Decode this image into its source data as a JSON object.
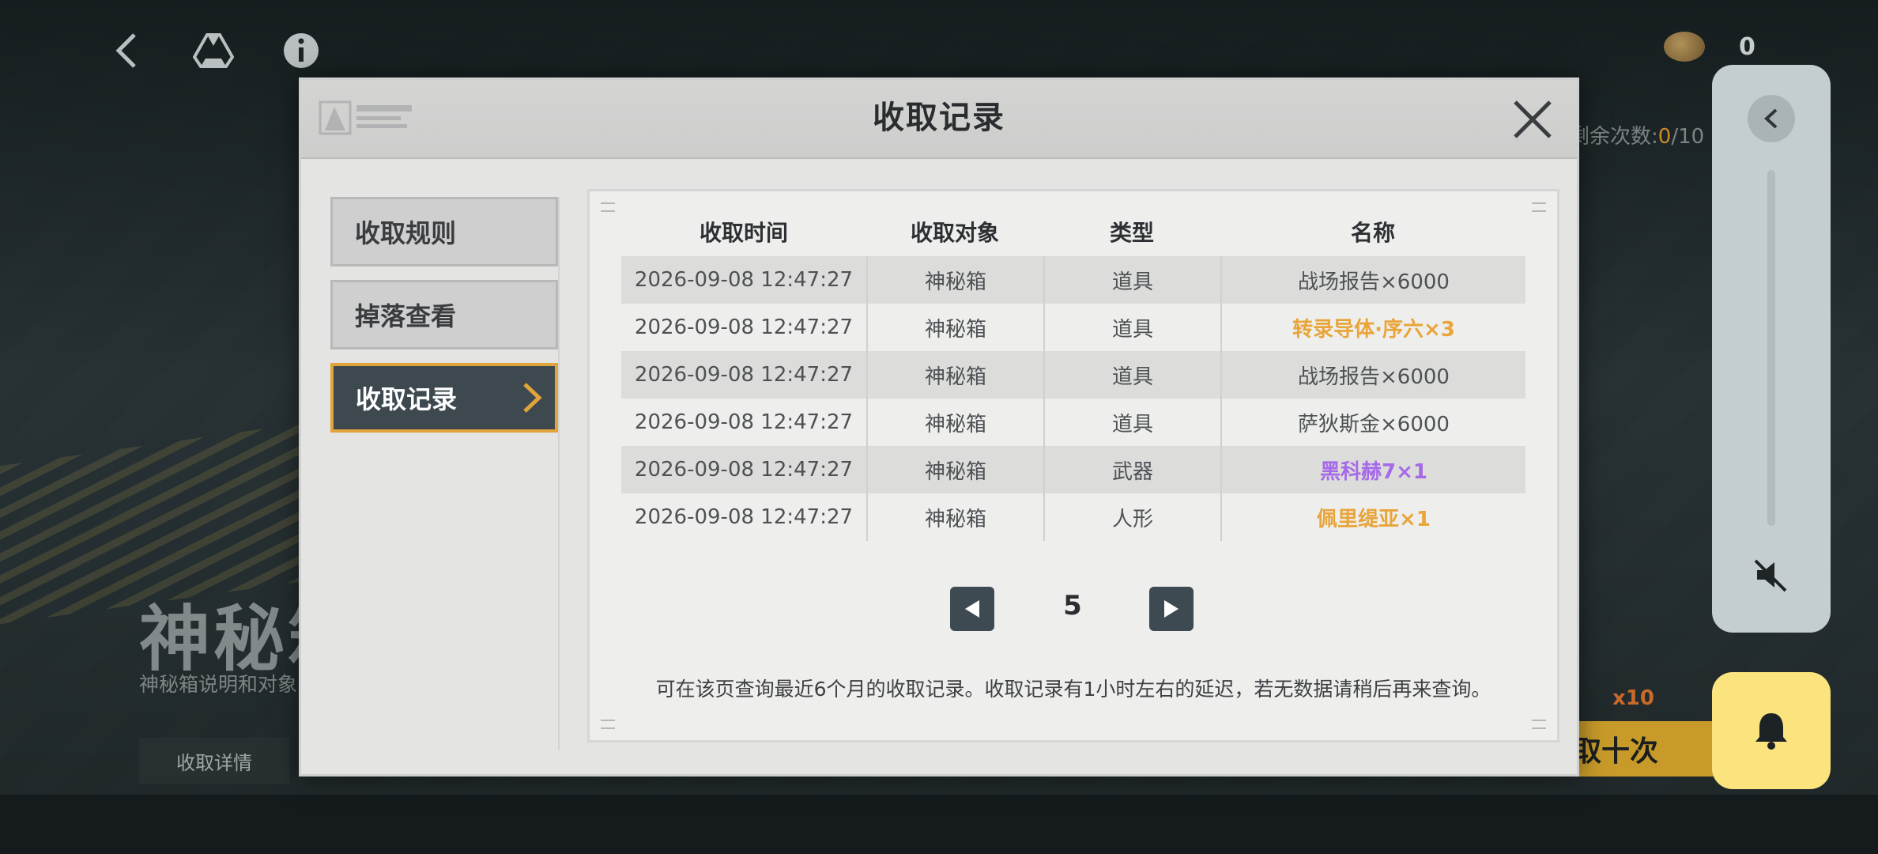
{
  "background": {
    "title": "神秘箱",
    "description": "神秘箱说明和对象",
    "detail_button": "收取详情",
    "remaining_label": "剩余次数:",
    "remaining_current": "0",
    "remaining_sep": "/10",
    "ten_button": "取十次",
    "multiplier": "x10"
  },
  "topbar": {
    "currency_count": "0"
  },
  "modal": {
    "title": "收取记录",
    "nav": [
      {
        "label": "收取规则"
      },
      {
        "label": "掉落查看"
      },
      {
        "label": "收取记录"
      }
    ],
    "table": {
      "headers": [
        "收取时间",
        "收取对象",
        "类型",
        "名称"
      ],
      "rows": [
        {
          "time": "2026-09-08 12:47:27",
          "target": "神秘箱",
          "type": "道具",
          "name": "战场报告×6000",
          "rarity": "normal"
        },
        {
          "time": "2026-09-08 12:47:27",
          "target": "神秘箱",
          "type": "道具",
          "name": "转录导体·序六×3",
          "rarity": "gold"
        },
        {
          "time": "2026-09-08 12:47:27",
          "target": "神秘箱",
          "type": "道具",
          "name": "战场报告×6000",
          "rarity": "normal"
        },
        {
          "time": "2026-09-08 12:47:27",
          "target": "神秘箱",
          "type": "道具",
          "name": "萨狄斯金×6000",
          "rarity": "normal"
        },
        {
          "time": "2026-09-08 12:47:27",
          "target": "神秘箱",
          "type": "武器",
          "name": "黑科赫7×1",
          "rarity": "purple"
        },
        {
          "time": "2026-09-08 12:47:27",
          "target": "神秘箱",
          "type": "人形",
          "name": "佩里缇亚×1",
          "rarity": "gold"
        }
      ]
    },
    "page": "5",
    "note": "可在该页查询最近6个月的收取记录。收取记录有1小时左右的延迟，若无数据请稍后再来查询。"
  },
  "colors": {
    "gold": "#e8a53a",
    "purple": "#a56ae8",
    "normal": "#4d5154",
    "active_border": "#e0a43a",
    "bell": "#fbe47e"
  },
  "icons": [
    "back-icon",
    "drive-icon",
    "info-icon",
    "coin-icon",
    "close-icon",
    "chevron-right-icon",
    "prev-page-icon",
    "next-page-icon",
    "collapse-icon",
    "mute-icon",
    "bell-icon"
  ]
}
